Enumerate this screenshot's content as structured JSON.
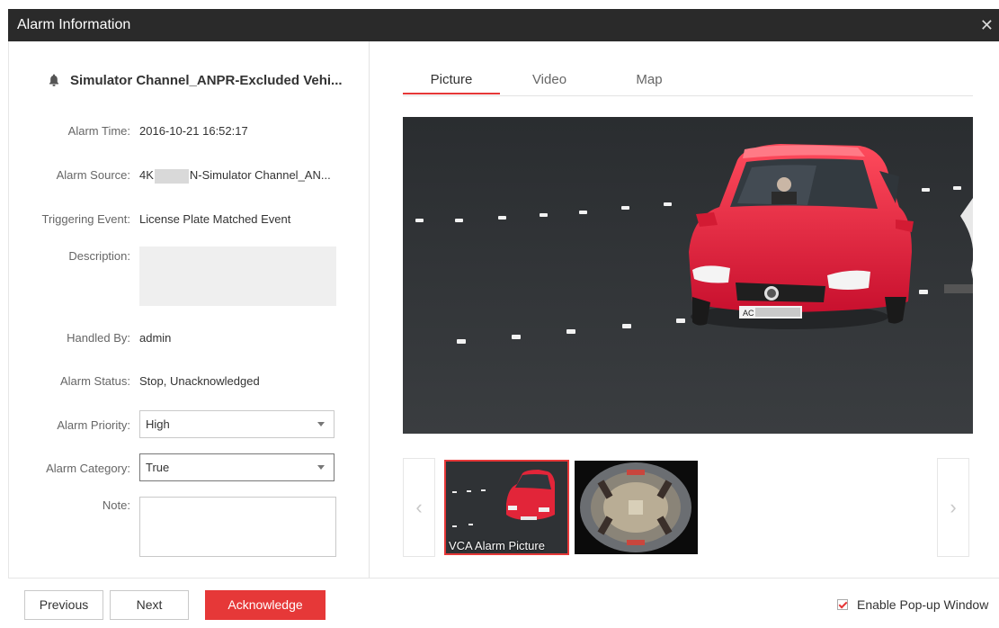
{
  "window": {
    "title": "Alarm Information",
    "close_glyph": "✕"
  },
  "alarm": {
    "title": "Simulator Channel_ANPR-Excluded Vehi...",
    "icon": "bell-icon"
  },
  "fields": {
    "alarm_time_label": "Alarm Time:",
    "alarm_time_value": "2016-10-21 16:52:17",
    "alarm_source_label": "Alarm Source:",
    "alarm_source_prefix": "4K",
    "alarm_source_suffix": "N-Simulator Channel_AN...",
    "triggering_event_label": "Triggering Event:",
    "triggering_event_value": "License Plate Matched Event",
    "description_label": "Description:",
    "description_value": "",
    "handled_by_label": "Handled By:",
    "handled_by_value": "admin",
    "alarm_status_label": "Alarm Status:",
    "alarm_status_value": "Stop, Unacknowledged",
    "alarm_priority_label": "Alarm Priority:",
    "alarm_priority_value": "High",
    "alarm_category_label": "Alarm Category:",
    "alarm_category_value": "True",
    "note_label": "Note:",
    "note_value": ""
  },
  "tabs": [
    {
      "label": "Picture",
      "active": true
    },
    {
      "label": "Video",
      "active": false
    },
    {
      "label": "Map",
      "active": false
    }
  ],
  "thumbnails": [
    {
      "label": "VCA Alarm Picture",
      "selected": true,
      "kind": "red car capture"
    },
    {
      "label": "",
      "selected": false,
      "kind": "fisheye store view"
    }
  ],
  "nav": {
    "prev_glyph": "‹",
    "next_glyph": "›"
  },
  "footer": {
    "previous_label": "Previous",
    "next_label": "Next",
    "acknowledge_label": "Acknowledge",
    "enable_popup_label": "Enable Pop-up Window",
    "enable_popup_checked": true
  },
  "colors": {
    "accent": "#e63838",
    "titlebar": "#2a2a2a"
  }
}
